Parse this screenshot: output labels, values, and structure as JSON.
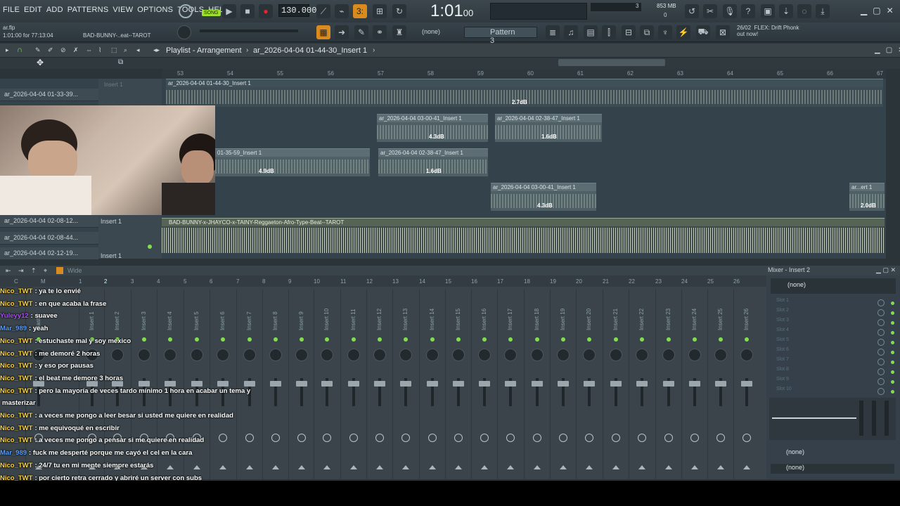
{
  "menu": [
    "FILE",
    "EDIT",
    "ADD",
    "PATTERNS",
    "VIEW",
    "OPTIONS",
    "TOOLS",
    "HELP"
  ],
  "transport": {
    "song_label": "SONG",
    "tempo": "130.000",
    "time": "1:01",
    "time_ms": "00",
    "cpu": "853 MB",
    "poly": "3",
    "zero": "0"
  },
  "hint": {
    "file": "ar.flp",
    "position": "1:01:00 for 77:13:04",
    "track": "BAD-BUNNY-..eat--TAROT"
  },
  "pattern": {
    "none": "(none)",
    "name": "Pattern 3"
  },
  "news": {
    "date": "26/02",
    "text1": "FLEX: Drift Phonk",
    "text2": "out now!"
  },
  "playlist": {
    "title": "Playlist - Arrangement",
    "breadcrumb": "ar_2026-04-04 01-44-30_Insert 1",
    "ruler": [
      "53",
      "54",
      "55",
      "56",
      "57",
      "58",
      "59",
      "60",
      "61",
      "62",
      "63",
      "64",
      "65",
      "66",
      "67"
    ],
    "tracks": [
      "ar_2026-04-04 01-33-39...",
      "ar_2026-04-04 02-08-12...",
      "ar_2026-04-04 02-08-44...",
      "ar_2026-04-04 02-12-19..."
    ],
    "insert_labels": [
      "Insert 1",
      "Insert 1",
      "Insert 1"
    ],
    "clips": [
      {
        "label": "ar_2026-04-04 01-44-30_Insert 1",
        "db": "2.7dB"
      },
      {
        "label": "ar_2026-04-04 03-00-41_Insert 1",
        "db": "4.3dB"
      },
      {
        "label": "ar_2026-04-04 02-38-47_Insert 1",
        "db": "1.6dB"
      },
      {
        "label": "01-35-59_Insert 1",
        "db": "4.9dB"
      },
      {
        "label": "ar_2026-04-04 02-38-47_Insert 1",
        "db": "1.6dB"
      },
      {
        "label": "ar_2026-04-04 03-00-41_Insert 1",
        "db": "4.3dB"
      },
      {
        "label": "ar...ert 1",
        "db": "2.0dB"
      }
    ],
    "main_clip": "BAD-BUNNY-x-JHAYCO-x-TAINY-Reggaeton-Afro-Type-Beat--TAROT"
  },
  "mixer": {
    "view": "Wide",
    "strip_names": [
      "Master",
      "Insert 1",
      "Insert 2",
      "Insert 3",
      "Insert 4",
      "Insert 5",
      "Insert 6",
      "Insert 7",
      "Insert 8",
      "Insert 9",
      "Insert 10",
      "Insert 11",
      "Insert 12",
      "Insert 13",
      "Insert 14",
      "Insert 15",
      "Insert 16",
      "Insert 17",
      "Insert 18",
      "Insert 19",
      "Insert 20",
      "Insert 21",
      "Insert 22",
      "Insert 23",
      "Insert 24",
      "Insert 25",
      "Insert 26"
    ],
    "numbers": [
      "C",
      "M",
      "1",
      "2",
      "3",
      "4",
      "5",
      "6",
      "7",
      "8",
      "9",
      "10",
      "11",
      "12",
      "13",
      "14",
      "15",
      "16",
      "17",
      "18",
      "19",
      "20",
      "21",
      "22",
      "23",
      "24",
      "25",
      "26"
    ]
  },
  "insert_panel": {
    "title": "Mixer - Insert 2",
    "preset": "(none)",
    "slots": [
      "Slot 1",
      "Slot 2",
      "Slot 3",
      "Slot 4",
      "Slot 5",
      "Slot 6",
      "Slot 7",
      "Slot 8",
      "Slot 9",
      "Slot 10"
    ],
    "out1": "(none)",
    "out2": "(none)"
  },
  "chat": [
    {
      "user": "Nico_TWT",
      "color": "#ffd23a",
      "text": ": ya te lo envié"
    },
    {
      "user": "Nico_TWT",
      "color": "#ffd23a",
      "text": ": en que acaba la frase"
    },
    {
      "user": "Yuleyy12",
      "color": "#b04bff",
      "text": ": suavee"
    },
    {
      "user": "Mar_989",
      "color": "#5aa0ff",
      "text": ": yeah"
    },
    {
      "user": "Nico_TWT",
      "color": "#ffd23a",
      "text": ": estuchaste mal y soy mexico"
    },
    {
      "user": "Nico_TWT",
      "color": "#ffd23a",
      "text": ": me demoré 2 horas"
    },
    {
      "user": "Nico_TWT",
      "color": "#ffd23a",
      "text": ": y eso por pausas"
    },
    {
      "user": "Nico_TWT",
      "color": "#ffd23a",
      "text": ": el beat me demore 3 horas"
    },
    {
      "user": "Nico_TWT",
      "color": "#ffd23a",
      "text": ": pero la mayoría de veces tardo mínimo 1 hora en acabar un tema y"
    },
    {
      "user": "",
      "color": "#ffd23a",
      "text": "masterizar"
    },
    {
      "user": "Nico_TWT",
      "color": "#ffd23a",
      "text": ": a veces me pongo a leer besar si usted me quiere en realidad"
    },
    {
      "user": "Nico_TWT",
      "color": "#ffd23a",
      "text": ": me equivoqué en escribir"
    },
    {
      "user": "Nico_TWT",
      "color": "#ffd23a",
      "text": ": a veces me pongo a pensar si me quiere en realidad"
    },
    {
      "user": "Mar_989",
      "color": "#5aa0ff",
      "text": ": fuck me desperté porque me cayó el cel en la cara"
    },
    {
      "user": "Nico_TWT",
      "color": "#ffd23a",
      "text": ": 24/7 tu en mi mente siempre estarás"
    },
    {
      "user": "Nico_TWT",
      "color": "#ffd23a",
      "text": ": por cierto retra cerrado y abriré un server con subs"
    }
  ]
}
